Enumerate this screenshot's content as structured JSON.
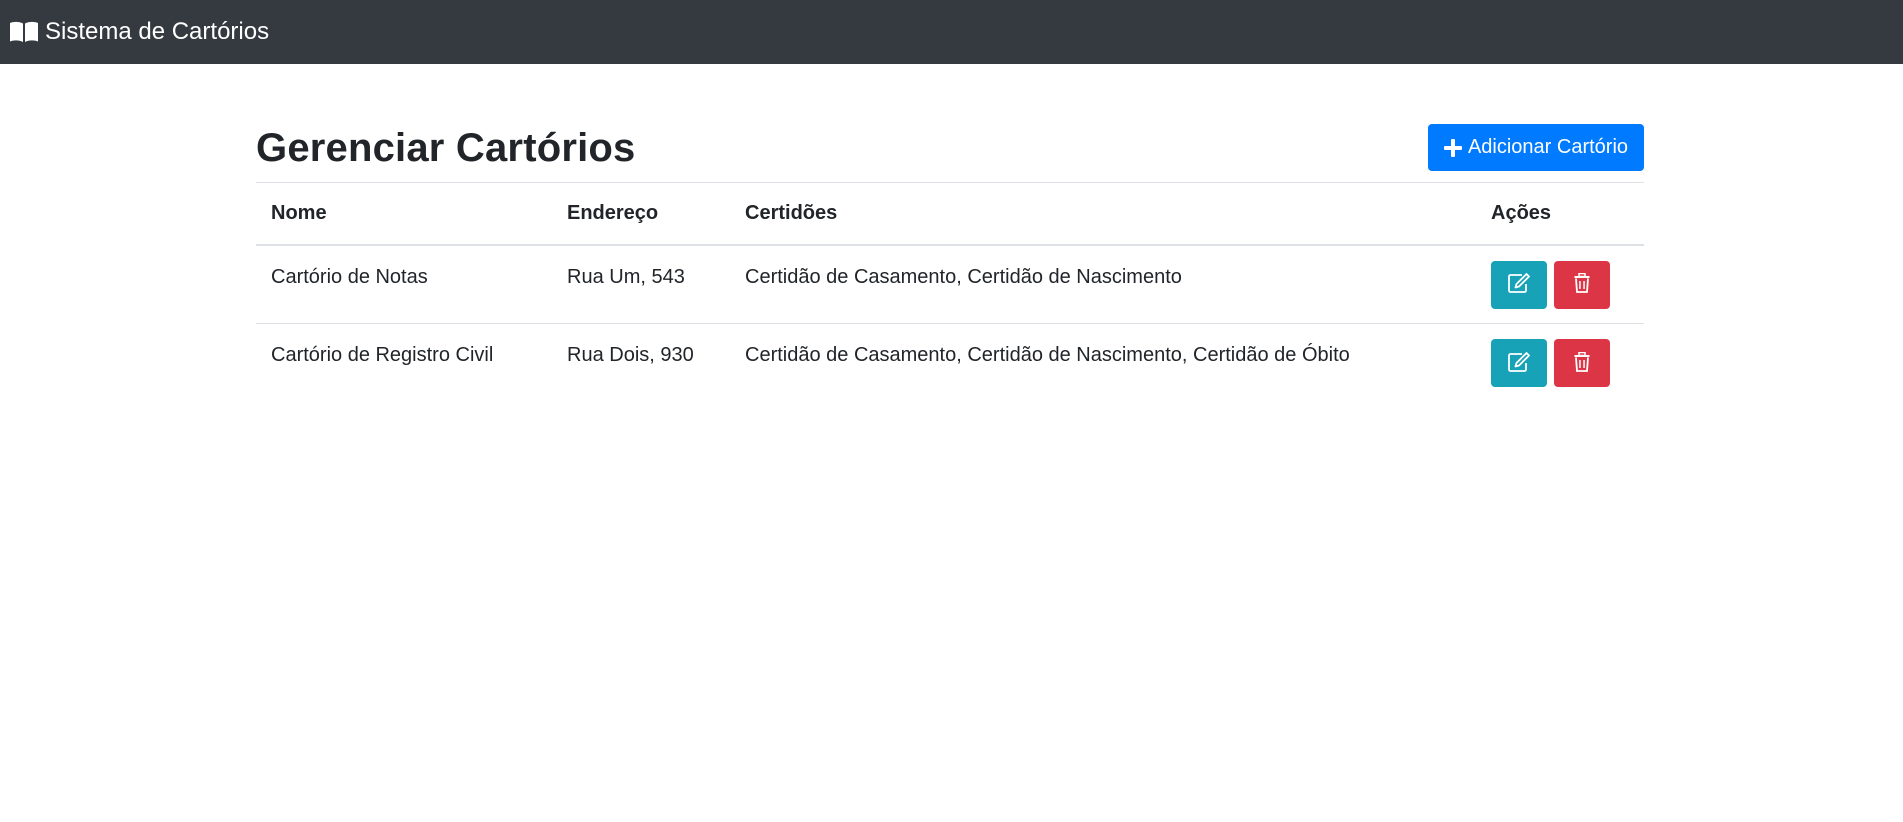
{
  "navbar": {
    "brand_title": "Sistema de Cartórios",
    "brand_icon": "book-open-icon"
  },
  "page": {
    "title": "Gerenciar Cartórios",
    "add_button_label": "Adicionar Cartório",
    "add_button_icon": "plus-icon"
  },
  "table": {
    "headers": [
      "Nome",
      "Endereço",
      "Certidões",
      "Ações"
    ],
    "rows": [
      {
        "nome": "Cartório de Notas",
        "endereco": "Rua Um, 543",
        "certidoes": "Certidão de Casamento, Certidão de Nascimento"
      },
      {
        "nome": "Cartório de Registro Civil",
        "endereco": "Rua Dois, 930",
        "certidoes": "Certidão de Casamento, Certidão de Nascimento, Certidão de Óbito"
      }
    ],
    "action_icons": [
      "edit-icon",
      "trash-icon"
    ]
  },
  "colors": {
    "navbar_bg": "#343a40",
    "primary": "#007bff",
    "info": "#17a2b8",
    "danger": "#dc3545"
  }
}
